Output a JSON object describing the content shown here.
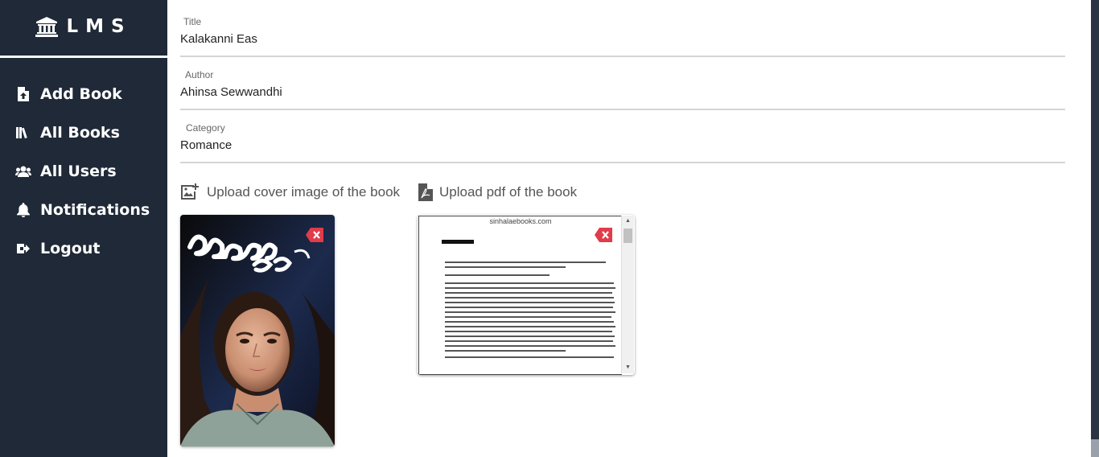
{
  "brand": {
    "text": "LMS",
    "icon": "institution-icon"
  },
  "nav": {
    "items": [
      {
        "label": "Add Book",
        "icon": "file-upload-icon"
      },
      {
        "label": "All Books",
        "icon": "books-icon"
      },
      {
        "label": "All Users",
        "icon": "users-icon"
      },
      {
        "label": "Notifications",
        "icon": "bell-icon"
      },
      {
        "label": "Logout",
        "icon": "logout-icon"
      }
    ]
  },
  "form": {
    "title": {
      "label": "Title",
      "value": "Kalakanni Eas"
    },
    "author": {
      "label": "Author",
      "value": "Ahinsa Sewwandhi"
    },
    "category": {
      "label": "Category",
      "value": "Romance"
    }
  },
  "uploads": {
    "cover_label": "Upload cover image of the book",
    "pdf_label": "Upload pdf of the book",
    "cover_title_art": "කාලකන්නි ඇස්",
    "pdf_site": "sinhalaebooks.com"
  },
  "colors": {
    "sidebar": "#1f2937",
    "remove_button": "#e03c4a",
    "text": "#222222"
  }
}
